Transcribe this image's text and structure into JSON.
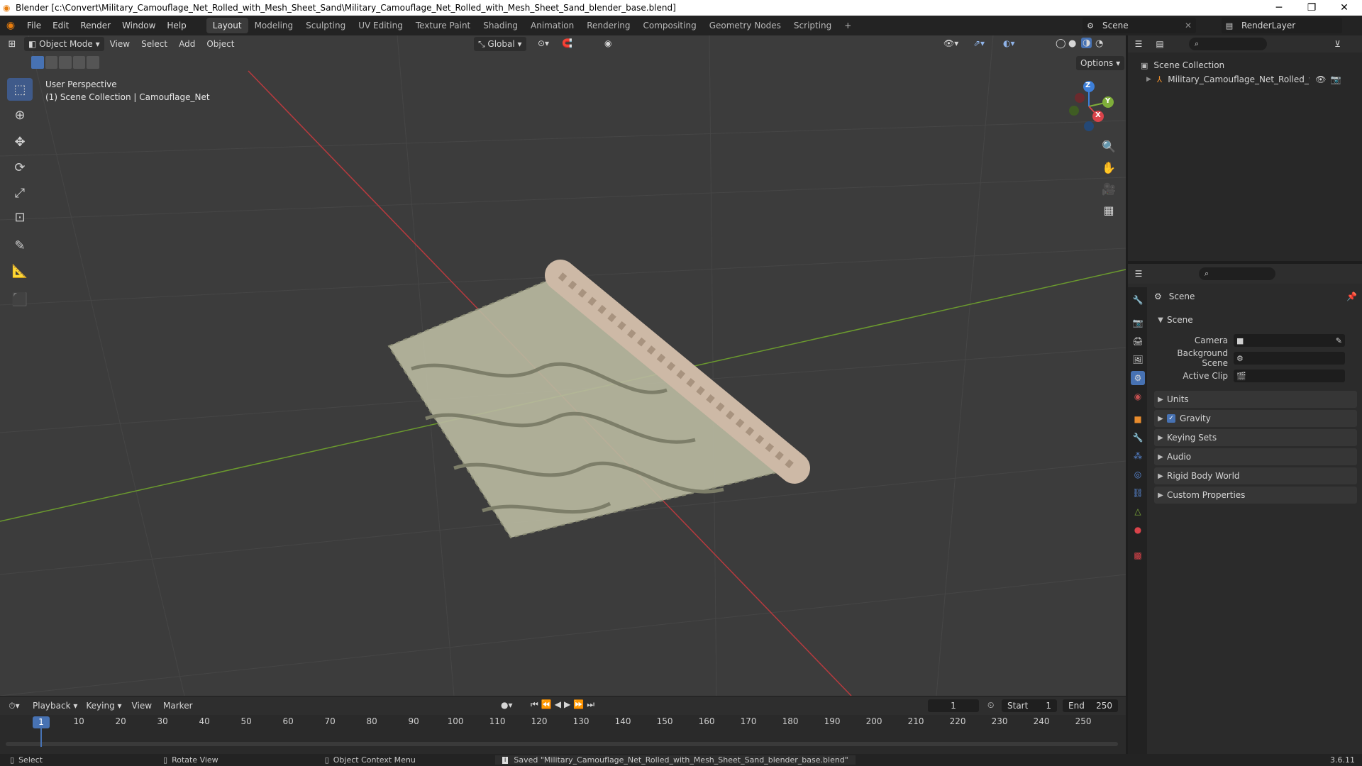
{
  "window": {
    "title": "Blender [c:\\Convert\\Military_Camouflage_Net_Rolled_with_Mesh_Sheet_Sand\\Military_Camouflage_Net_Rolled_with_Mesh_Sheet_Sand_blender_base.blend]",
    "minimize": "─",
    "maximize": "❐",
    "close": "✕"
  },
  "menubar": {
    "items": [
      "File",
      "Edit",
      "Render",
      "Window",
      "Help"
    ]
  },
  "workspaces": [
    "Layout",
    "Modeling",
    "Sculpting",
    "UV Editing",
    "Texture Paint",
    "Shading",
    "Animation",
    "Rendering",
    "Compositing",
    "Geometry Nodes",
    "Scripting"
  ],
  "workspace_add": "+",
  "scene_selector": "Scene",
  "view_layer": "RenderLayer",
  "viewport": {
    "mode": "Object Mode",
    "menus": [
      "View",
      "Select",
      "Add",
      "Object"
    ],
    "transform_orientation": "Global",
    "options": "Options",
    "overlay_line1": "User Perspective",
    "overlay_line2": "(1) Scene Collection | Camouflage_Net",
    "gizmo": {
      "z": "Z",
      "y": "Y",
      "x": "X"
    }
  },
  "outliner": {
    "root": "Scene Collection",
    "item": "Military_Camouflage_Net_Rolled_with_M"
  },
  "properties": {
    "context": "Scene",
    "section": "Scene",
    "fields": [
      {
        "label": "Camera",
        "value": ""
      },
      {
        "label": "Background Scene",
        "value": ""
      },
      {
        "label": "Active Clip",
        "value": ""
      }
    ],
    "panels": [
      "Units",
      "Gravity",
      "Keying Sets",
      "Audio",
      "Rigid Body World",
      "Custom Properties"
    ]
  },
  "timeline": {
    "menus": [
      "Playback",
      "Keying",
      "View",
      "Marker"
    ],
    "current_frame": "1",
    "start_label": "Start",
    "start": "1",
    "end_label": "End",
    "end": "250",
    "ticks": [
      "1",
      "10",
      "20",
      "30",
      "40",
      "50",
      "60",
      "70",
      "80",
      "90",
      "100",
      "110",
      "120",
      "130",
      "140",
      "150",
      "160",
      "170",
      "180",
      "190",
      "200",
      "210",
      "220",
      "230",
      "240",
      "250"
    ]
  },
  "statusbar": {
    "select": "Select",
    "rotate": "Rotate View",
    "context": "Object Context Menu",
    "message": "Saved \"Military_Camouflage_Net_Rolled_with_Mesh_Sheet_Sand_blender_base.blend\"",
    "version": "3.6.11"
  },
  "colors": {
    "accent": "#4772b3",
    "x_axis": "#d9434a",
    "y_axis": "#7fae3a",
    "z_axis": "#3d7fd9"
  }
}
